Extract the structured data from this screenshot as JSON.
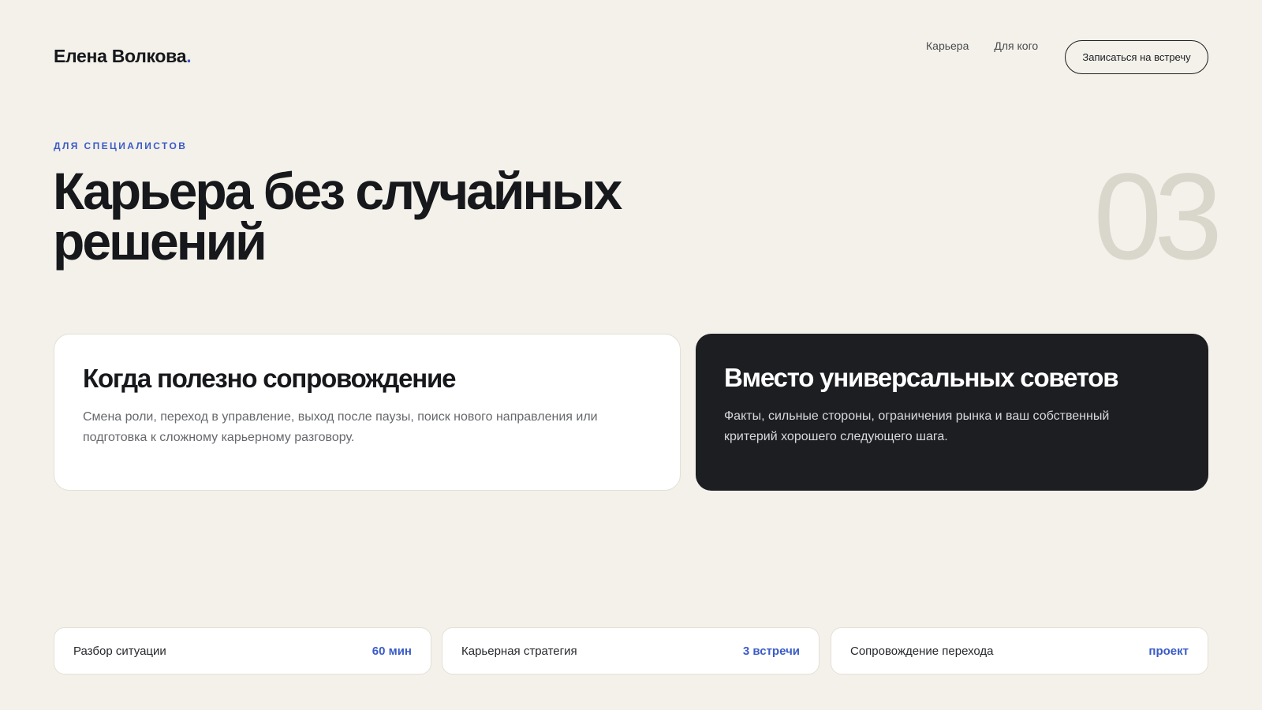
{
  "header": {
    "logo_text": "Елена Волкова",
    "logo_dot": ".",
    "nav": [
      {
        "label": "Карьера"
      },
      {
        "label": "Для кого"
      }
    ],
    "cta_label": "Записаться на встречу"
  },
  "hero": {
    "eyebrow": "ДЛЯ СПЕЦИАЛИСТОВ",
    "title_line1": "Карьера без случайных",
    "title_line2": "решений",
    "step_number": "03"
  },
  "cards": [
    {
      "title": "Когда полезно сопровождение",
      "text_line1": "Смена роли, переход в управление, выход после паузы, поиск нового направления или",
      "text_line2": "подготовка к сложному карьерному разговору."
    },
    {
      "title": "Вместо универсальных советов",
      "text_line1": "Факты, сильные стороны, ограничения рынка и ваш собственный",
      "text_line2": "критерий хорошего следующего шага."
    }
  ],
  "services": [
    {
      "name": "Разбор ситуации",
      "meta": "60 мин"
    },
    {
      "name": "Карьерная стратегия",
      "meta": "3 встречи"
    },
    {
      "name": "Сопровождение перехода",
      "meta": "проект"
    }
  ],
  "colors": {
    "background": "#f4f1ea",
    "accent": "#3a5bc7",
    "dark_card": "#1c1e22",
    "step_number": "#d9d6cb"
  }
}
